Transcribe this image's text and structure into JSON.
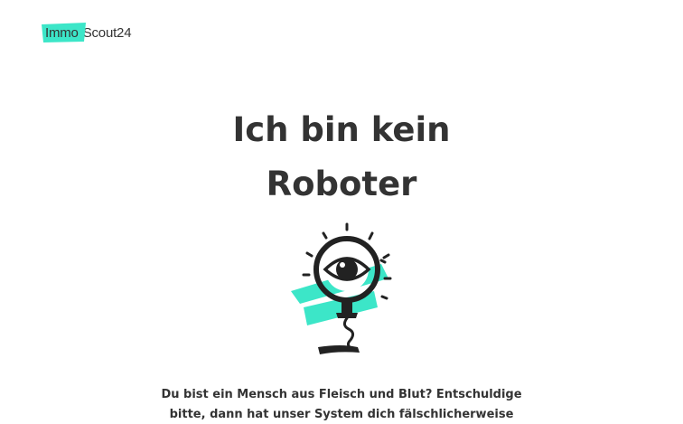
{
  "brand": {
    "logo_part1": "Immo",
    "logo_part2": "Scout24",
    "accent_color": "#3ce6c8",
    "text_color": "#333333"
  },
  "main": {
    "title_line1": "Ich bin kein",
    "title_line2": "Roboter",
    "illustration_icon": "magnifying-glass-eye-icon",
    "body_line1": "Du bist ein Mensch aus Fleisch und Blut? Entschuldige",
    "body_line2": "bitte, dann hat unser System dich fälschlicherweise"
  }
}
